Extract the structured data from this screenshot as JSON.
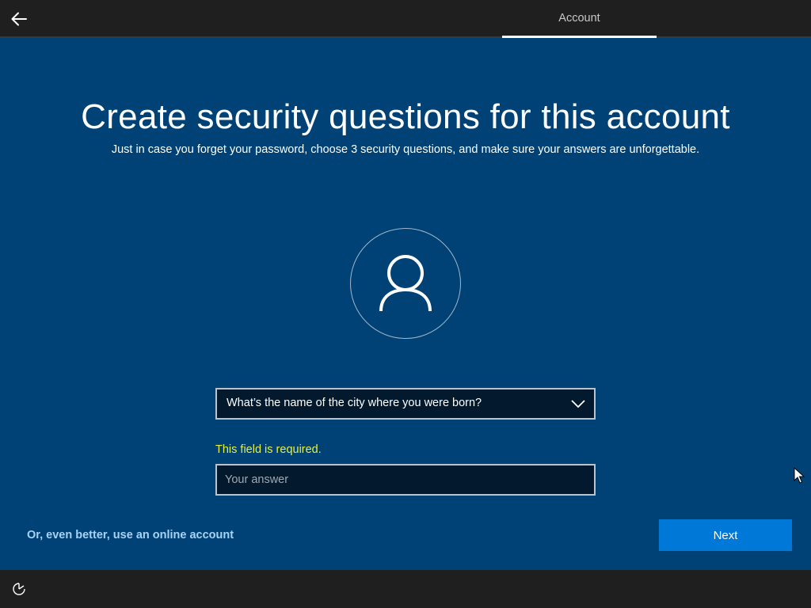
{
  "header": {
    "tab_label": "Account",
    "back_icon": "arrow-left-icon"
  },
  "main": {
    "title": "Create security questions for this account",
    "subtitle": "Just in case you forget your password, choose 3 security questions, and make sure your answers are unforgettable.",
    "avatar_icon": "person-icon",
    "question_select": {
      "selected": "What’s the name of the city where you were born?",
      "icon": "chevron-down-icon"
    },
    "error_text": "This field is required.",
    "answer_input": {
      "value": "",
      "placeholder": "Your answer"
    }
  },
  "footer": {
    "online_account_link": "Or, even better, use an online account",
    "next_label": "Next",
    "ease_icon": "ease-of-access-icon"
  },
  "colors": {
    "background": "#004275",
    "topbar": "#1f1f1f",
    "accent_button": "#0078d7",
    "error": "#e6ef3a",
    "link": "#a8d3f5"
  }
}
